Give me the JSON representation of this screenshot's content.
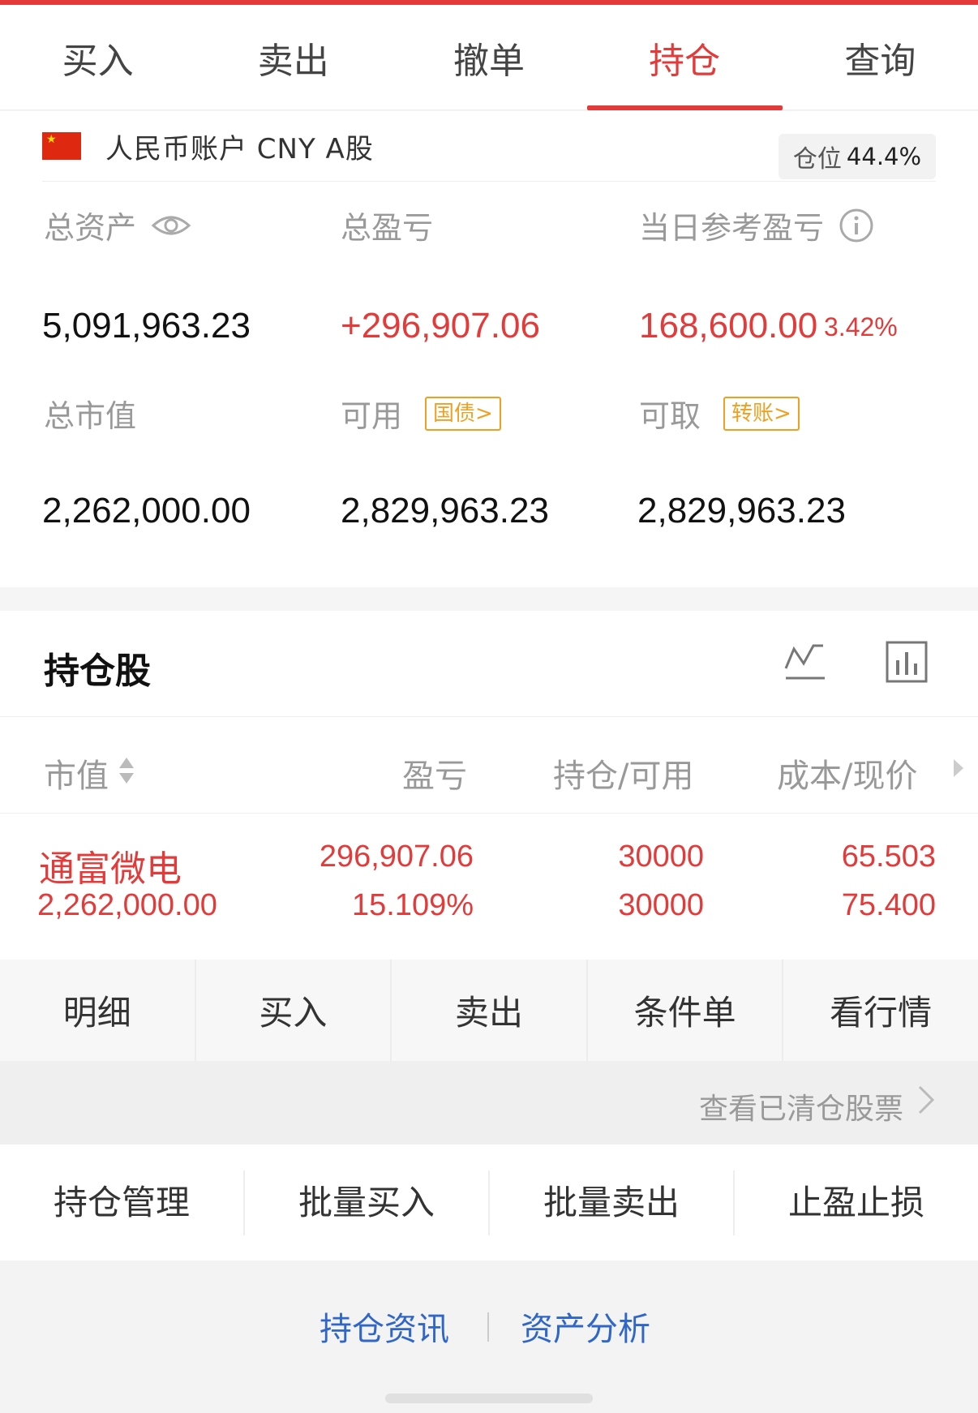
{
  "tabs": [
    {
      "label": "买入",
      "active": false
    },
    {
      "label": "卖出",
      "active": false
    },
    {
      "label": "撤单",
      "active": false
    },
    {
      "label": "持仓",
      "active": true
    },
    {
      "label": "查询",
      "active": false
    }
  ],
  "account": {
    "label": "人民币账户 CNY A股",
    "position_label": "仓位",
    "position_value": "44.4%",
    "total_assets_label": "总资产",
    "total_assets": "5,091,963.23",
    "total_pnl_label": "总盈亏",
    "total_pnl": "+296,907.06",
    "daily_pnl_label": "当日参考盈亏",
    "daily_pnl": "168,600.00",
    "daily_pnl_pct": "3.42%",
    "market_value_label": "总市值",
    "market_value": "2,262,000.00",
    "available_label": "可用",
    "available_tag": "国债>",
    "available": "2,829,963.23",
    "withdrawable_label": "可取",
    "withdrawable_tag": "转账>",
    "withdrawable": "2,829,963.23"
  },
  "holdings": {
    "title": "持仓股",
    "columns": {
      "market_value": "市值",
      "pnl": "盈亏",
      "qty": "持仓/可用",
      "cost": "成本/现价"
    },
    "rows": [
      {
        "name": "通富微电",
        "market_value": "2,262,000.00",
        "pnl": "296,907.06",
        "pnl_pct": "15.109%",
        "holding": "30000",
        "available": "30000",
        "cost": "65.503",
        "price": "75.400"
      }
    ]
  },
  "row_actions": [
    "明细",
    "买入",
    "卖出",
    "条件单",
    "看行情"
  ],
  "cleared_link": "查看已清仓股票",
  "bulk_actions": [
    "持仓管理",
    "批量买入",
    "批量卖出",
    "止盈止损"
  ],
  "bottom_links": [
    "持仓资讯",
    "资产分析"
  ],
  "colors": {
    "accent": "#e33a3a",
    "tag": "#f0a020",
    "link": "#2f66c7"
  }
}
